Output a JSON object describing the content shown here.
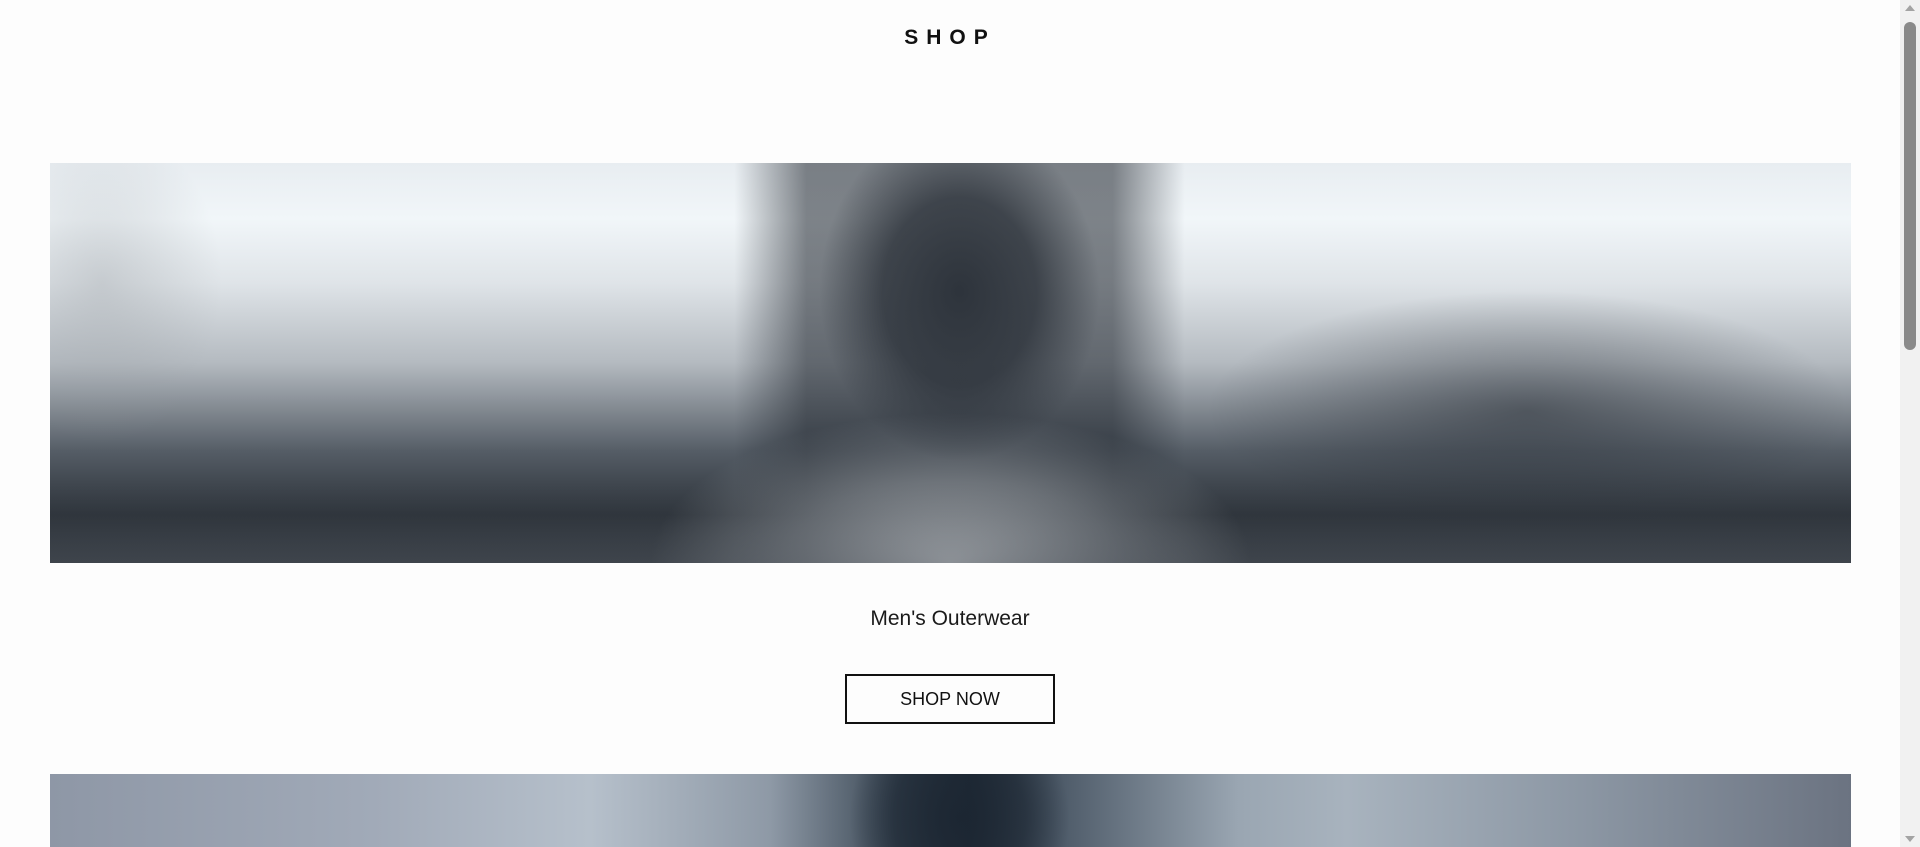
{
  "header": {
    "title": "SHOP"
  },
  "sections": [
    {
      "name": "Men's Outerwear",
      "cta_label": "SHOP NOW"
    }
  ],
  "colors": {
    "background": "#fdfdfd",
    "text": "#1a1a1a",
    "button_border": "#111111"
  },
  "icons": {
    "scroll_up": "triangle-up-icon",
    "scroll_down": "triangle-down-icon"
  }
}
